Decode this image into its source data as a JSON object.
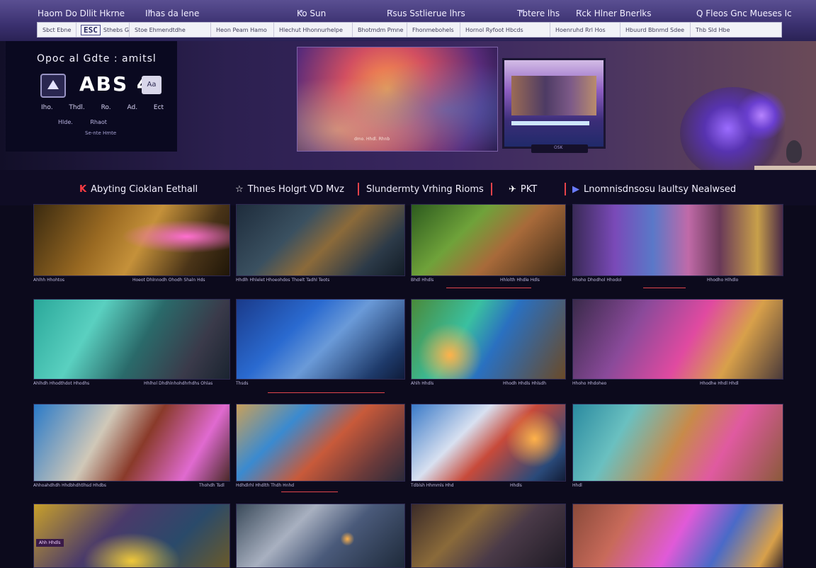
{
  "nav": {
    "menu": [
      {
        "label": "Haom Do Dllit Hkrne"
      },
      {
        "label": "Ilhas da lene"
      },
      {
        "label": "Ko Sun"
      },
      {
        "label": "Rsus Sstlierue lhrs"
      },
      {
        "label": "Tbtere lhs"
      },
      {
        "label": "Rck Hlner Bnerlks"
      },
      {
        "label": "Q Fleos Gnc Mueses Ic"
      }
    ],
    "toolbar": [
      {
        "label": "Sbct Ebne"
      },
      {
        "label": "ESC"
      },
      {
        "label": "Sthebs Gldlo"
      },
      {
        "label": "Stoe Ehmendtdhe"
      },
      {
        "label": "Heon Peam Hamo"
      },
      {
        "label": "Hlechut Hhonnurhelpe"
      },
      {
        "label": "Bhotmdm Pmne"
      },
      {
        "label": "Fhonmebohels"
      },
      {
        "label": "Hornol Ryfoot Hbcds"
      },
      {
        "label": "Hoenruhd Rrl Hos"
      },
      {
        "label": "Hbuurd Bbnmd Sdee"
      },
      {
        "label": "Thb Sld Hbe"
      }
    ]
  },
  "hero": {
    "title": "Opoc al Gdte  : amitsl",
    "big": "ABS 4",
    "box": "Aa",
    "sub": "Iho. Thdl. Ro. Ad. Ect",
    "sub2": "Hlde. Rhaot",
    "sub3": "Se-nte Hmte",
    "art_sig": "dmo. Hhdl. Rhnb",
    "stand_label": "OSK"
  },
  "sections": [
    {
      "icon": "K",
      "label": "Abyting Cioklan Eethall"
    },
    {
      "icon": "☆",
      "label": "Thnes Holgrt VD Mvz"
    },
    {
      "icon": "",
      "label": "Slundermty Vrhing Rioms"
    },
    {
      "icon": "✈",
      "label": "PKT"
    },
    {
      "icon": "▶",
      "label": "Lnomnisdnsosu laultsy Nealwsed"
    }
  ],
  "cards": [
    {
      "caption": "Ahlhh Hhohtos",
      "caption2": "Hoeot Dhlnnodh Ohodh Shaln Hds"
    },
    {
      "caption": "Hhdlh Hhlelet Hhoeohdos Thoelt Tadhl Teots",
      "caption2": ""
    },
    {
      "caption": "Bhdl Hhdls",
      "caption2": "Hhlolth Hhdle Hdls"
    },
    {
      "caption": "Hhoho Dhodhol Hhodol",
      "caption2": "Hhodho Hlhdlo"
    },
    {
      "caption": "Ahlhdh Hhodthdot Hhodhs",
      "caption2": "Hhlhol Dhdhlnhohdhrhdhs Ohlas"
    },
    {
      "caption": "Thsds",
      "caption2": ""
    },
    {
      "caption": "Ahlh Hhdls",
      "caption2": "Hhodh Hhdls Hhlsdh"
    },
    {
      "caption": "Hhoho Hhdoheo",
      "caption2": "Hhodhe Hhdl Hhdl"
    },
    {
      "caption": "Ahhoahdhdh Hhdbhdhtlhsd Hhdbs",
      "caption2": "Thohdh Tsdl"
    },
    {
      "caption": "Hdhdlrhl Hhdlth Thdh Hnhd",
      "caption2": ""
    },
    {
      "caption": "Tdblsh Hhmmls Hhd",
      "caption2": "Hhdls"
    },
    {
      "caption": "Hhdl",
      "caption2": ""
    },
    {
      "caption": "Ahh Hhdls",
      "caption2": ""
    },
    {
      "caption": "",
      "caption2": ""
    },
    {
      "caption": "",
      "caption2": ""
    },
    {
      "caption": "",
      "caption2": ""
    }
  ]
}
